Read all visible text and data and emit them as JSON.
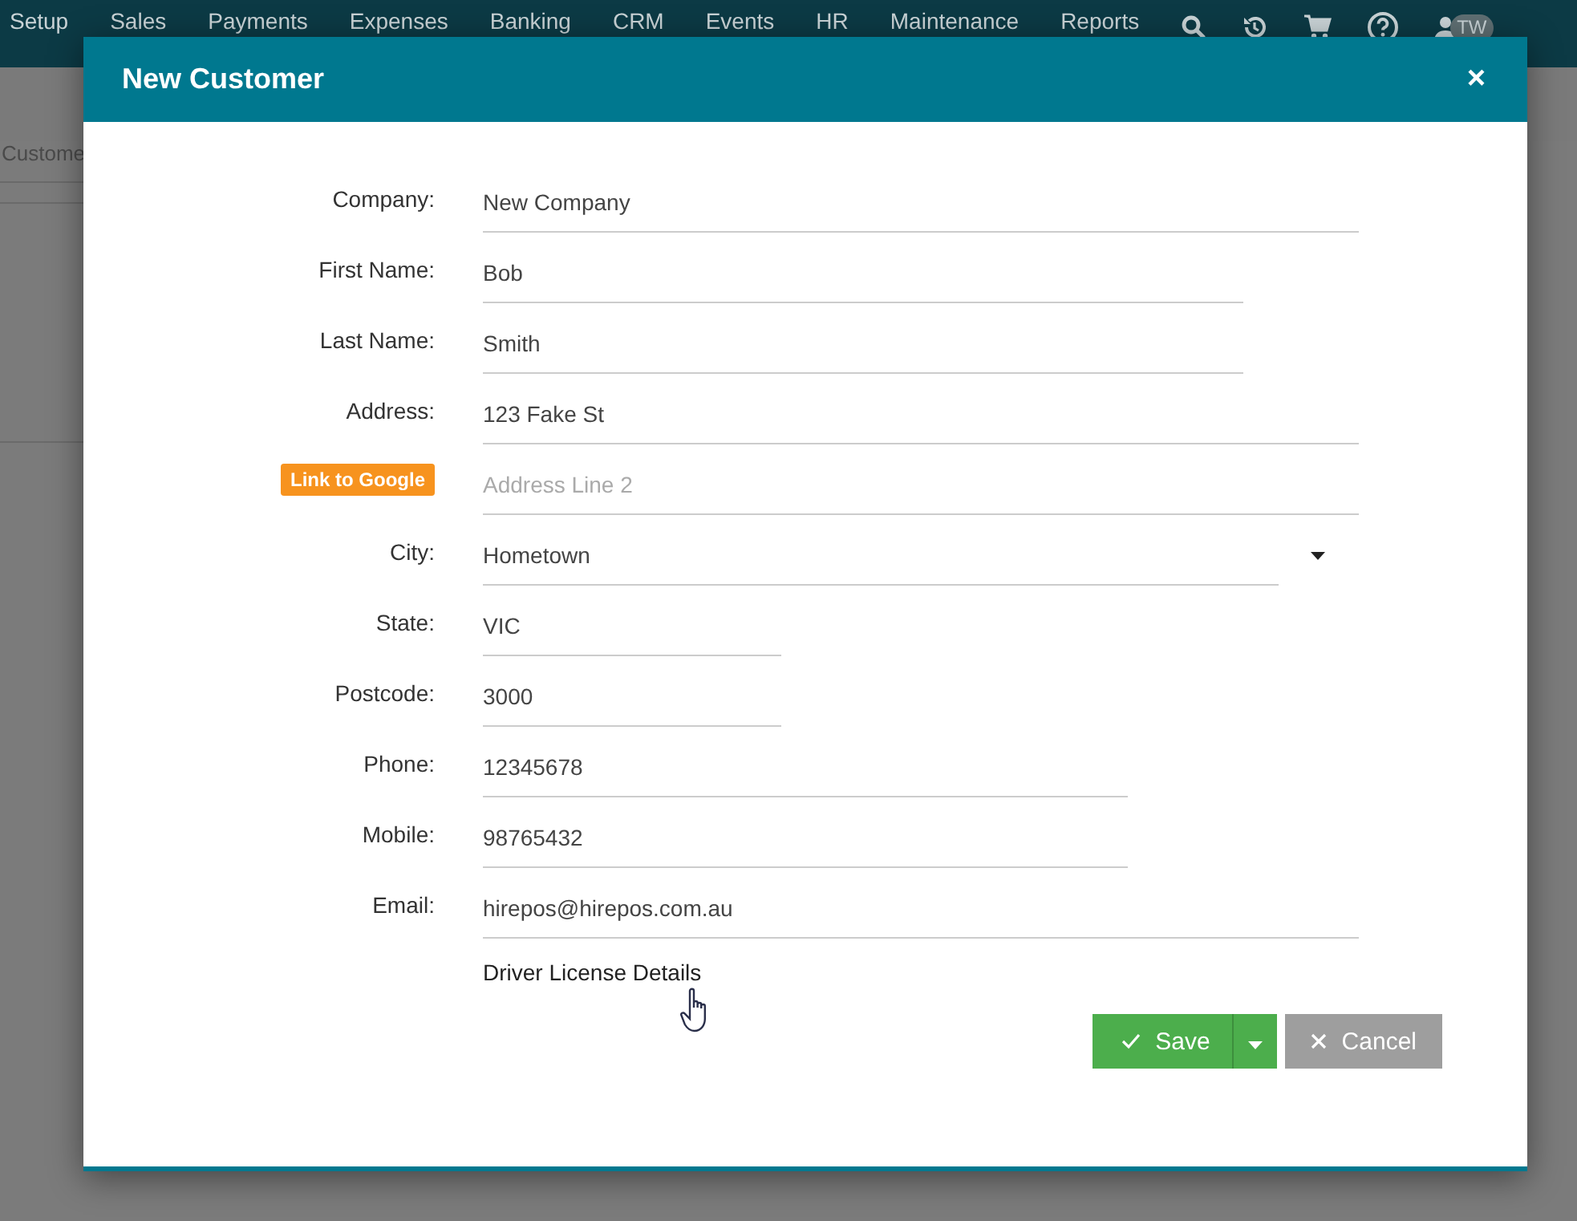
{
  "nav": {
    "items": [
      "Setup",
      "Sales",
      "Payments",
      "Expenses",
      "Banking",
      "CRM",
      "Events",
      "HR",
      "Maintenance",
      "Reports"
    ],
    "user_initials": "TW"
  },
  "background_page": {
    "tab": "Custome"
  },
  "dialog": {
    "title": "New Customer",
    "close": "×",
    "fields": [
      {
        "kind": "text",
        "label": "Company:",
        "value": "New Company"
      },
      {
        "kind": "text",
        "label": "First Name:",
        "value": "Bob"
      },
      {
        "kind": "text",
        "label": "Last Name:",
        "value": "Smith"
      },
      {
        "kind": "text",
        "label": "Address:",
        "value": "123 Fake St"
      },
      {
        "kind": "link",
        "link_label": "Link to Google",
        "placeholder": "Address Line 2"
      },
      {
        "kind": "select",
        "label": "City:",
        "value": "Hometown"
      },
      {
        "kind": "text",
        "label": "State:",
        "value": "VIC"
      },
      {
        "kind": "text",
        "label": "Postcode:",
        "value": "3000"
      },
      {
        "kind": "text",
        "label": "Phone:",
        "value": "12345678"
      },
      {
        "kind": "text",
        "label": "Mobile:",
        "value": "98765432"
      },
      {
        "kind": "text",
        "label": "Email:",
        "value": "hirepos@hirepos.com.au"
      }
    ],
    "section_link": "Driver License Details",
    "buttons": [
      {
        "kind": "save",
        "label": "Save"
      },
      {
        "kind": "cancel",
        "label": "Cancel"
      }
    ]
  }
}
